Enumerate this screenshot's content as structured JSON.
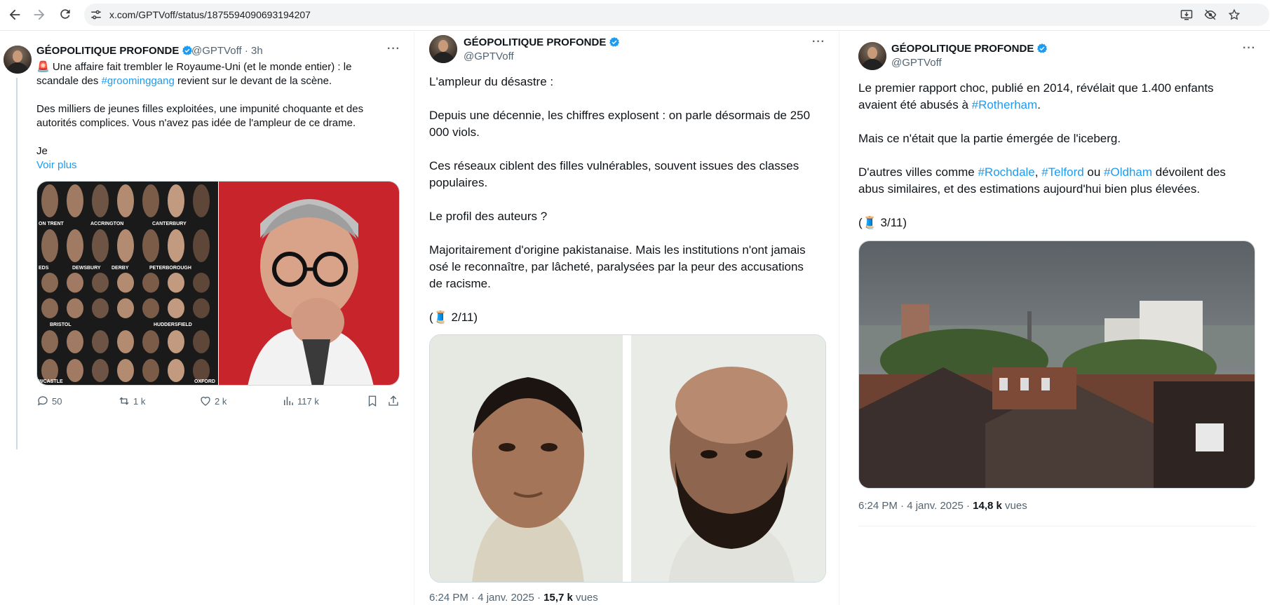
{
  "browser": {
    "url": "x.com/GPTVoff/status/1875594090693194207"
  },
  "author": {
    "name": "GÉOPOLITIQUE PROFONDE",
    "handle": "@GPTVoff"
  },
  "tweet1": {
    "time": "· 3h",
    "text_a": "🚨 Une affaire fait trembler le Royaume-Uni (et le monde entier) : le",
    "text_b_pre": "scandale des ",
    "hashtag": "#groominggang",
    "text_b_post": " revient sur le devant de la scène.",
    "text_c": "Des milliers de jeunes filles exploitées, une impunité choquante et des",
    "text_d": "autorités complices. Vous n'avez pas idée de l'ampleur de ce drame.",
    "text_e": "Je",
    "see_more": "Voir plus",
    "grid_labels": [
      "ON TRENT",
      "ACCRINGTON",
      "CANTERBURY",
      "EDS",
      "DEWSBURY",
      "DERBY",
      "PETERBOROUGH",
      "BRISTOL",
      "HUDDERSFIELD",
      "WCASTLE",
      "OXFORD"
    ],
    "stats": {
      "replies": "50",
      "reposts": "1 k",
      "likes": "2 k",
      "views": "117 k"
    }
  },
  "tweet2": {
    "l1": "L'ampleur du désastre :",
    "l2": "Depuis une décennie, les chiffres explosent : on parle désormais de 250",
    "l3": "000 viols.",
    "l4": "Ces réseaux ciblent des filles vulnérables, souvent issues des classes",
    "l5": "populaires.",
    "l6": "Le profil des auteurs ?",
    "l7": "Majoritairement d'origine pakistanaise. Mais les institutions n'ont jamais",
    "l8": "osé le reconnaître, par lâcheté, paralysées par la peur des accusations",
    "l9": "de racisme.",
    "counter": "(🧵 2/11)",
    "meta_date": "6:24 PM · 4 janv. 2025 · ",
    "meta_views": "15,7 k",
    "meta_views_label": " vues"
  },
  "tweet3": {
    "l1": "Le premier rapport choc, publié en 2014, révélait que 1.400 enfants",
    "l2_pre": "avaient été abusés à ",
    "l2_tag": "#Rotherham",
    "l2_post": ".",
    "l3": "Mais ce n'était que la partie émergée de l'iceberg.",
    "l4_pre": "D'autres villes comme ",
    "l4_tag1": "#Rochdale",
    "l4_sep1": ", ",
    "l4_tag2": "#Telford",
    "l4_sep2": " ou ",
    "l4_tag3": "#Oldham",
    "l4_post": " dévoilent des",
    "l5": "abus similaires, et des estimations aujourd'hui bien plus élevées.",
    "counter": "(🧵 3/11)",
    "meta_date": "6:24 PM · 4 janv. 2025 · ",
    "meta_views": "14,8 k",
    "meta_views_label": " vues"
  },
  "colors": {
    "link": "#1d9bf0",
    "text": "#0f1419",
    "secondary": "#536471",
    "verified": "#1d9bf0"
  },
  "icons": [
    "back-arrow-icon",
    "forward-arrow-icon",
    "reload-icon",
    "site-info-icon",
    "install-app-icon",
    "eye-off-icon",
    "star-icon",
    "reply-icon",
    "repost-icon",
    "like-icon",
    "views-icon",
    "bookmark-icon",
    "share-icon",
    "verified-icon",
    "more-icon"
  ]
}
